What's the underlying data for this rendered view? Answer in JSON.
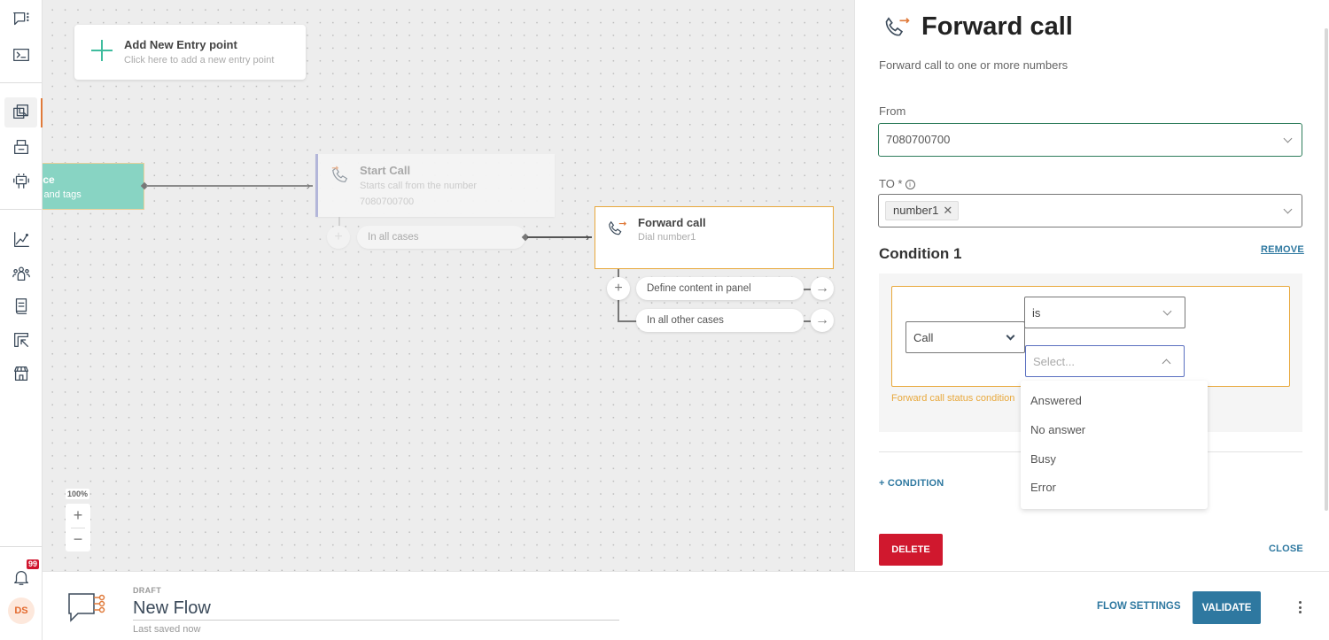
{
  "sidebar": {
    "items": [
      {
        "name": "chat-menu-icon"
      },
      {
        "name": "terminal-icon"
      },
      {
        "name": "flows-icon",
        "active": true
      },
      {
        "name": "inbox-icon"
      },
      {
        "name": "bot-icon"
      },
      {
        "name": "analytics-icon"
      },
      {
        "name": "contacts-icon"
      },
      {
        "name": "docs-icon"
      },
      {
        "name": "integrations-icon"
      },
      {
        "name": "store-icon"
      }
    ],
    "notifications_badge": "99",
    "avatar_initials": "DS",
    "accent_color": "#e07a3a"
  },
  "canvas": {
    "entry_point": {
      "title": "Add New Entry point",
      "subtitle": "Click here to add a new entry point"
    },
    "teal_node": {
      "title": "nce",
      "subtitle": "s and tags"
    },
    "start_call": {
      "title": "Start Call",
      "subtitle": "Starts call from the number",
      "number": "7080700700",
      "branch_label": "In all cases"
    },
    "forward_call": {
      "title": "Forward call",
      "subtitle": "Dial number1",
      "branches": [
        {
          "label": "Define content in panel"
        },
        {
          "label": "In all other cases"
        }
      ]
    },
    "zoom_level": "100%",
    "zoom_in": "+",
    "zoom_out": "−"
  },
  "panel": {
    "title": "Forward call",
    "description": "Forward call to one or more numbers",
    "from_label": "From",
    "from_value": "7080700700",
    "to_label": "TO *",
    "to_chips": [
      "number1"
    ],
    "condition_title": "Condition 1",
    "remove_label": "REMOVE",
    "condition": {
      "field": "Call",
      "operator": "is",
      "value_placeholder": "Select...",
      "warning": "Forward call status condition"
    },
    "dropdown_options": [
      "Answered",
      "No answer",
      "Busy",
      "Error"
    ],
    "add_condition_label": "+ CONDITION",
    "delete_label": "DELETE",
    "close_label": "CLOSE"
  },
  "bottom_bar": {
    "status": "DRAFT",
    "flow_name": "New Flow",
    "saved_text": "Last saved now",
    "flow_settings_label": "FLOW SETTINGS",
    "validate_label": "VALIDATE"
  },
  "colors": {
    "primary": "#2e78a0",
    "danger": "#d0182e",
    "warning": "#e8a83c",
    "teal": "#88d4c3",
    "brand_orange": "#e07a3a"
  }
}
